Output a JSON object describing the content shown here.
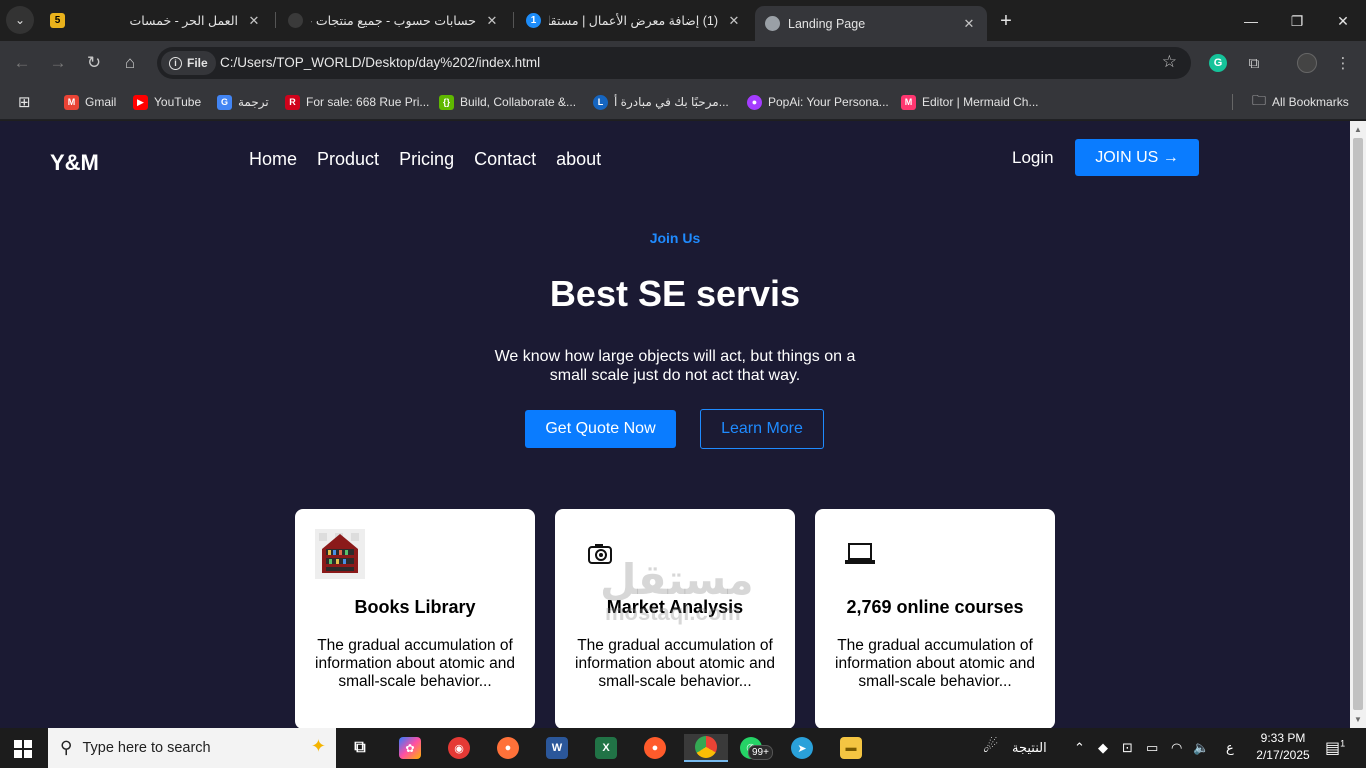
{
  "browser": {
    "tabs": [
      {
        "title": "العمل الحر - خمسات",
        "favicon_letter": "5",
        "favicon_color": "#e9b21c"
      },
      {
        "title": "حسابات حسوب - جميع منتجات حسوب",
        "favicon_letter": "",
        "favicon_color": "#3a3a3a"
      },
      {
        "title": "(1) إضافة معرض الأعمال | مستقل",
        "favicon_letter": "1",
        "favicon_color": "#1d8cf8"
      },
      {
        "title": "Landing Page",
        "favicon_letter": "",
        "favicon_color": "#9aa0a6"
      }
    ],
    "address_chip": "File",
    "url": "C:/Users/TOP_WORLD/Desktop/day%202/index.html",
    "bookmarks": [
      {
        "label": "Gmail",
        "icon_letter": "M",
        "icon_color": "#ea4335"
      },
      {
        "label": "YouTube",
        "icon_letter": "▶",
        "icon_color": "#ff0000"
      },
      {
        "label": "ترجمة",
        "icon_letter": "G",
        "icon_color": "#4285f4"
      },
      {
        "label": "For sale: 668 Rue Pri...",
        "icon_letter": "R",
        "icon_color": "#d0021b"
      },
      {
        "label": "Build, Collaborate &...",
        "icon_letter": "{}",
        "icon_color": "#5fb800"
      },
      {
        "label": "مرحبًا بك في مبادرة أ...",
        "icon_letter": "L",
        "icon_color": "#1565c0"
      },
      {
        "label": "PopAi: Your Persona...",
        "icon_letter": "●",
        "icon_color": "#a43cff"
      },
      {
        "label": "Editor | Mermaid Ch...",
        "icon_letter": "M",
        "icon_color": "#ff3670"
      }
    ],
    "all_bookmarks": "All Bookmarks"
  },
  "site": {
    "logo": "Y&M",
    "nav": [
      "Home",
      "Product",
      "Pricing",
      "Contact",
      "about"
    ],
    "login": "Login",
    "join": "JOIN US →",
    "eyebrow": "Join Us",
    "title": "Best SE servis",
    "subtitle": "We know how large objects will act, but things on a small scale just do not act that way.",
    "primary_cta": "Get Quote Now",
    "secondary_cta": "Learn More",
    "cards": [
      {
        "title": "Books Library",
        "text": "The gradual accumulation of information about atomic and small-scale behavior...",
        "icon": "books-icon"
      },
      {
        "title": "Market Analysis",
        "text": "The gradual accumulation of information about atomic and small-scale behavior...",
        "icon": "camera-icon"
      },
      {
        "title": "2,769 online courses",
        "text": "The gradual accumulation of information about atomic and small-scale behavior...",
        "icon": "laptop-icon"
      }
    ],
    "accent_color": "#0a7cff",
    "background_color": "#1b1a33"
  },
  "taskbar": {
    "search_placeholder": "Type here to search",
    "badge": "99+",
    "weather_text": "النتيجة",
    "lang": "ع",
    "time": "9:33 PM",
    "date": "2/17/2025",
    "notification_count": "1"
  },
  "watermark": {
    "text": "مستقل",
    "sub": "mostaql.com"
  }
}
